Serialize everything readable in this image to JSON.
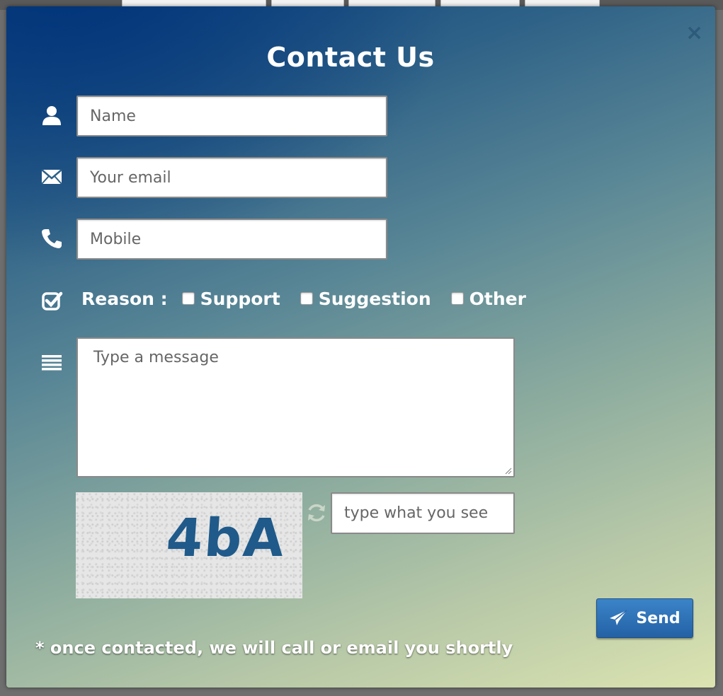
{
  "modal": {
    "title": "Contact Us",
    "close_glyph": "×",
    "fields": {
      "name_placeholder": "Name",
      "email_placeholder": "Your email",
      "mobile_placeholder": "Mobile"
    },
    "reason": {
      "label": "Reason :",
      "options": [
        "Support",
        "Suggestion",
        "Other"
      ]
    },
    "message_placeholder": "Type a message",
    "captcha": {
      "image_text": "4bA",
      "input_placeholder": "type what you see"
    },
    "send_label": "Send",
    "footnote": "* once contacted, we will call or email you shortly"
  },
  "icons": {
    "name": "user-icon",
    "email": "envelope-icon",
    "mobile": "phone-icon",
    "reason": "checkbox-icon",
    "message": "list-icon",
    "refresh": "refresh-icon",
    "send": "paper-plane-icon",
    "close": "close-icon"
  },
  "colors": {
    "send_button": "#2f72b8",
    "captcha_text": "#1f5a8a"
  }
}
